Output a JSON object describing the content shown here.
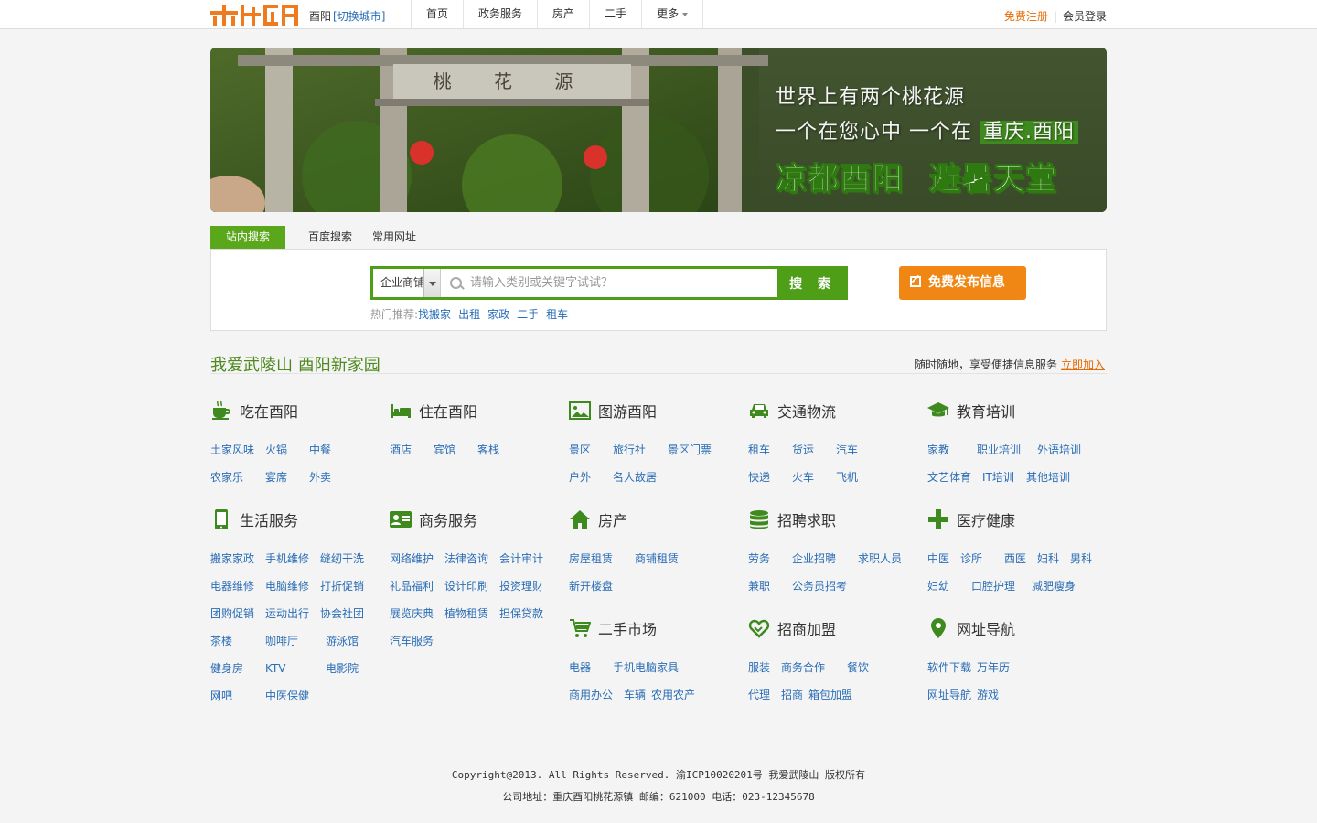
{
  "header": {
    "city": "酉阳",
    "switch_city": "[切换城市]",
    "nav": [
      "首页",
      "政务服务",
      "房产",
      "二手",
      "更多"
    ],
    "register": "免费注册",
    "login": "会员登录"
  },
  "banner": {
    "gate_text": "桃 花 源",
    "line1": "世界上有两个桃花源",
    "line2_prefix": "一个在您心中 一个在",
    "line2_highlight": "重庆.酉阳",
    "slogan_left": "凉都酉阳",
    "slogan_right": "避暑天堂"
  },
  "search": {
    "tabs": [
      "站内搜索",
      "百度搜索",
      "常用网址"
    ],
    "category": "企业商铺",
    "placeholder": "请输入类别或关键字试试？",
    "button": "搜 索",
    "hot_label": "热门推荐:",
    "hot_items": [
      "找搬家",
      "出租",
      "家政",
      "二手",
      "租车"
    ],
    "publish": "免费发布信息"
  },
  "section": {
    "title": "我爱武陵山 酉阳新家园",
    "right_text": "随时随地，享受便捷信息服务",
    "right_link": "立即加入"
  },
  "categories": [
    {
      "title": "吃在酉阳",
      "icon": "cup-icon",
      "rows": [
        [
          "土家风味",
          "火锅",
          "中餐"
        ],
        [
          "农家乐",
          "宴席",
          "外卖"
        ]
      ]
    },
    {
      "title": "住在酉阳",
      "icon": "bed-icon",
      "rows": [
        [
          "酒店",
          "宾馆",
          "客栈"
        ]
      ]
    },
    {
      "title": "图游酉阳",
      "icon": "picture-icon",
      "rows": [
        [
          "景区",
          "旅行社",
          "景区门票"
        ],
        [
          "户外",
          "名人故居"
        ]
      ]
    },
    {
      "title": "交通物流",
      "icon": "car-icon",
      "rows": [
        [
          "租车",
          "货运",
          "汽车"
        ],
        [
          "快递",
          "火车",
          "飞机"
        ]
      ]
    },
    {
      "title": "教育培训",
      "icon": "graduation-cap-icon",
      "rows": [
        [
          "家教",
          "职业培训",
          "外语培训"
        ],
        [
          "文艺体育",
          "IT培训",
          "其他培训"
        ]
      ]
    },
    {
      "title": "生活服务",
      "icon": "phone-icon",
      "rows": [
        [
          "搬家家政",
          "手机维修",
          "缝纫干洗"
        ],
        [
          "电器维修",
          "电脑维修",
          "打折促销"
        ],
        [
          "团购促销",
          "运动出行",
          "协会社团"
        ],
        [
          "茶楼",
          "咖啡厅",
          "游泳馆"
        ],
        [
          "健身房",
          "KTV",
          "电影院"
        ],
        [
          "网吧",
          "中医保健"
        ]
      ]
    },
    {
      "title": "商务服务",
      "icon": "id-card-icon",
      "rows": [
        [
          "网络维护",
          "法律咨询",
          "会计审计"
        ],
        [
          "礼品福利",
          "设计印刷",
          "投资理财"
        ],
        [
          "展览庆典",
          "植物租赁",
          "担保贷款"
        ],
        [
          "汽车服务"
        ]
      ]
    },
    {
      "title": "房产",
      "icon": "house-icon",
      "rows": [
        [
          "房屋租赁",
          "商铺租赁"
        ],
        [
          "新开楼盘"
        ]
      ]
    },
    {
      "title": "招聘求职",
      "icon": "database-icon",
      "rows": [
        [
          "劳务",
          "企业招聘",
          "求职人员"
        ],
        [
          "兼职",
          "公务员招考"
        ]
      ]
    },
    {
      "title": "医疗健康",
      "icon": "medical-cross-icon",
      "rows": [
        [
          "中医",
          "诊所",
          "西医",
          "妇科",
          "男科"
        ],
        [
          "妇幼",
          "口腔护理",
          "减肥瘦身"
        ]
      ]
    },
    {
      "title": "二手市场",
      "icon": "cart-icon",
      "rows": [
        [
          "电器",
          "手机电脑",
          "家具"
        ],
        [
          "商用办公",
          "车辆",
          "农用农产"
        ]
      ]
    },
    {
      "title": "招商加盟",
      "icon": "handshake-icon",
      "rows": [
        [
          "服装",
          "商务合作",
          "餐饮"
        ],
        [
          "代理",
          "招商",
          "箱包加盟"
        ]
      ]
    },
    {
      "title": "网址导航",
      "icon": "map-pin-icon",
      "rows": [
        [
          "软件下载",
          "万年历"
        ],
        [
          "网址导航",
          "游戏"
        ]
      ]
    }
  ],
  "footer": {
    "line1": "Copyright@2013. All Rights Reserved. 渝ICP10020201号 我爱武陵山 版权所有",
    "line2": "公司地址：重庆酉阳桃花源镇 邮编：621000 电话：023-12345678"
  },
  "colors": {
    "accent": "#4e9e17",
    "orange": "#f08613",
    "link": "#2a6db5"
  }
}
